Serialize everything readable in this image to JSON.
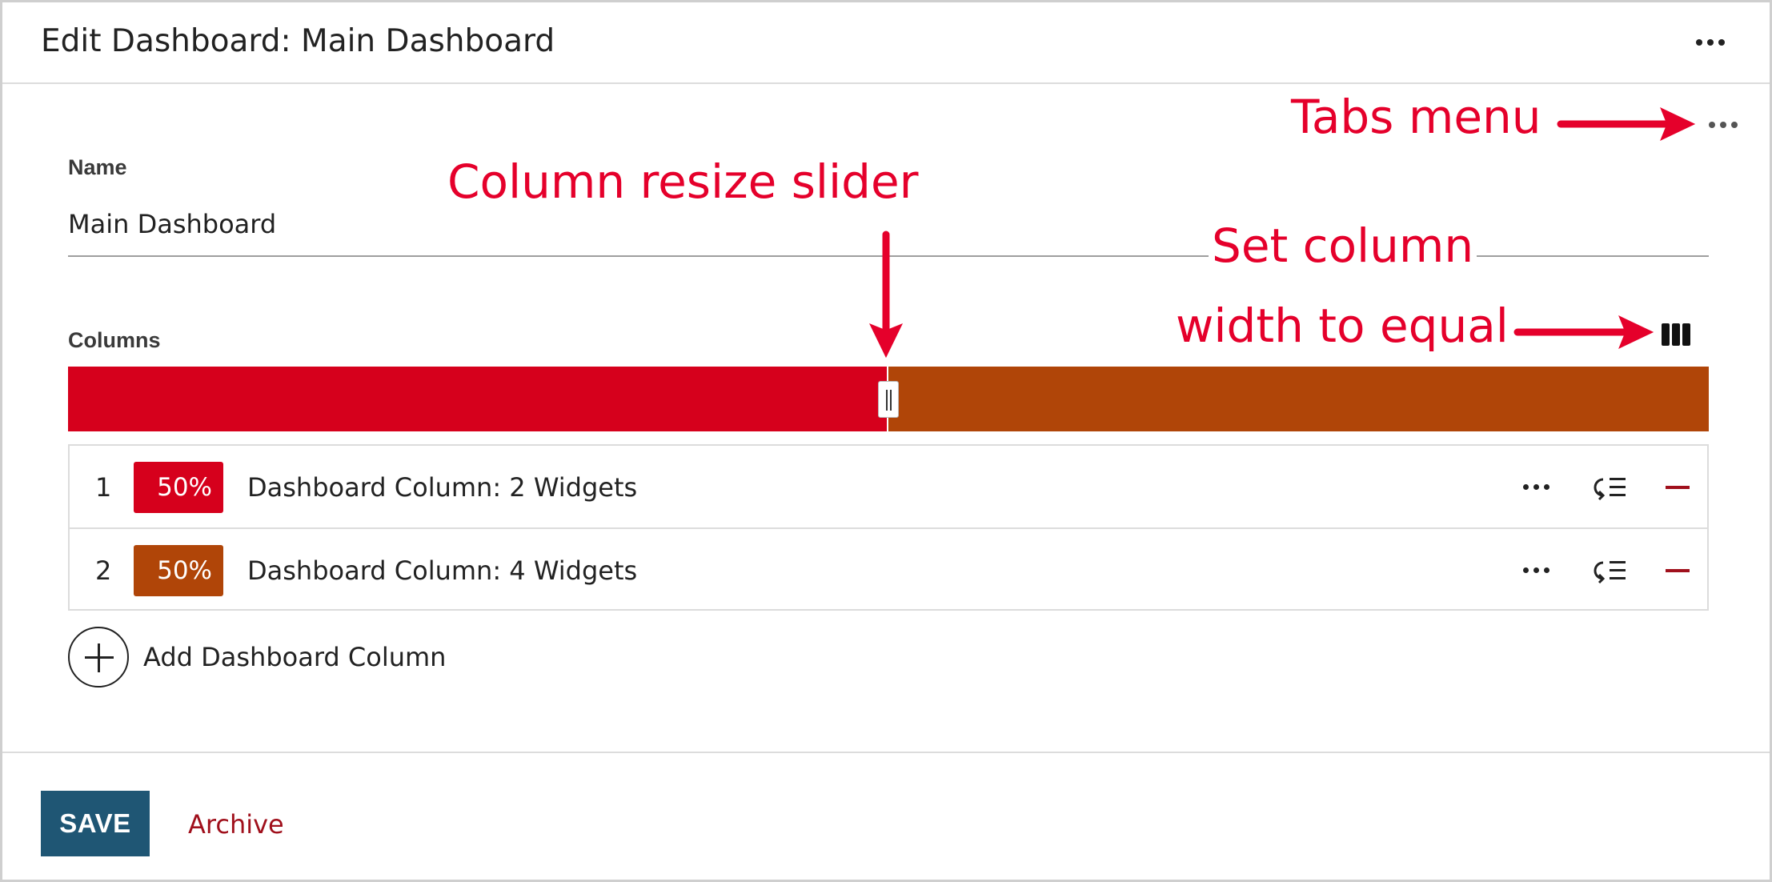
{
  "header": {
    "title": "Edit Dashboard: Main Dashboard",
    "menu_icon": "more-horizontal-icon"
  },
  "tabs_menu_icon": "more-horizontal-icon",
  "form": {
    "name_label": "Name",
    "name_value": "Main Dashboard",
    "columns_label": "Columns",
    "equal_width_icon": "columns-equal-icon"
  },
  "slider": {
    "segments": [
      {
        "fraction": 0.5,
        "color": "#d6001c"
      },
      {
        "fraction": 0.5,
        "color": "#b04508"
      }
    ]
  },
  "columns": [
    {
      "index": "1",
      "percent": "50%",
      "color": "#d6001c",
      "label": "Dashboard Column: 2 Widgets"
    },
    {
      "index": "2",
      "percent": "50%",
      "color": "#b04508",
      "label": "Dashboard Column: 4 Widgets"
    }
  ],
  "row_action_icons": [
    "more-horizontal-icon",
    "reorder-icon",
    "minus-icon"
  ],
  "add_column": {
    "label": "Add Dashboard Column",
    "icon": "plus-circle-icon"
  },
  "footer": {
    "save_label": "SAVE",
    "save_color": "#1f5674",
    "archive_label": "Archive",
    "archive_color": "#a0101c"
  },
  "annotations": {
    "color": "#e5002b",
    "tabs_menu": "Tabs menu",
    "resize_slider": "Column resize slider",
    "equal_line1": "Set column",
    "equal_line2": "width to equal"
  }
}
